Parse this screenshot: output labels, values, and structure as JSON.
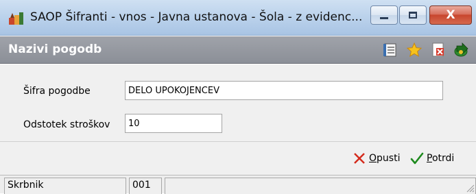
{
  "window": {
    "title": "SAOP Šifranti - vnos - Javna ustanova - Šola - z evidenc...",
    "app_icon": "saop-app-icon",
    "controls": {
      "minimize": "minimize-icon",
      "maximize": "maximize-icon",
      "close_label": "X"
    }
  },
  "subheader": {
    "title": "Nazivi pogodb",
    "toolbar_icons": [
      "list-icon",
      "star-icon",
      "delete-document-icon",
      "exit-icon"
    ]
  },
  "form": {
    "sifra": {
      "label": "Šifra pogodbe",
      "value": "DELO UPOKOJENCEV"
    },
    "odstotek": {
      "label": "Odstotek stroškov",
      "value": "10"
    }
  },
  "actions": {
    "cancel": {
      "underlined": "O",
      "rest": "pusti",
      "icon": "red-x-icon",
      "color": "#d42a1c"
    },
    "confirm": {
      "underlined": "P",
      "rest": "otrdi",
      "icon": "green-check-icon",
      "color": "#1e8a1e"
    }
  },
  "statusbar": {
    "label": "Skrbnik",
    "code": "001",
    "extra": ""
  }
}
